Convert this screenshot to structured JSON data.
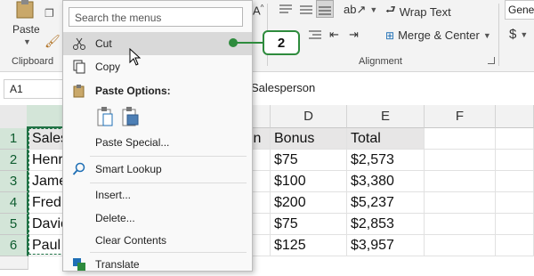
{
  "ribbon": {
    "paste_label": "Paste",
    "clipboard_group": "Clipboard",
    "alignment_group": "Alignment",
    "wrap_text": "Wrap Text",
    "merge_center": "Merge & Center",
    "number_format": "General",
    "currency_symbol": "$"
  },
  "formula_bar": {
    "name_box": "A1",
    "content": "Salesperson"
  },
  "sheet": {
    "columns": [
      "D",
      "E",
      "F"
    ],
    "rows": [
      "1",
      "2",
      "3",
      "4",
      "5",
      "6"
    ],
    "col_a_visible": [
      "Sales",
      "Henr",
      "Jame",
      "Fred",
      "Davic",
      "Paul"
    ],
    "col_c_visible": "ion",
    "bonus": [
      "Bonus",
      "$75",
      "$100",
      "$200",
      "$75",
      "$125"
    ],
    "total": [
      "Total",
      "$2,573",
      "$3,380",
      "$5,237",
      "$2,853",
      "$3,957"
    ]
  },
  "context_menu": {
    "search_placeholder": "Search the menus",
    "cut": "Cut",
    "copy": "Copy",
    "paste_options": "Paste Options:",
    "paste_special": "Paste Special...",
    "smart_lookup": "Smart Lookup",
    "insert": "Insert...",
    "delete": "Delete...",
    "clear_contents": "Clear Contents",
    "translate": "Translate"
  },
  "callout": {
    "step": "2",
    "color": "#2e8b3d"
  },
  "colors": {
    "excel_green": "#217346",
    "header_fill": "#e7e6e6",
    "menu_highlight": "#d9d9d9"
  }
}
